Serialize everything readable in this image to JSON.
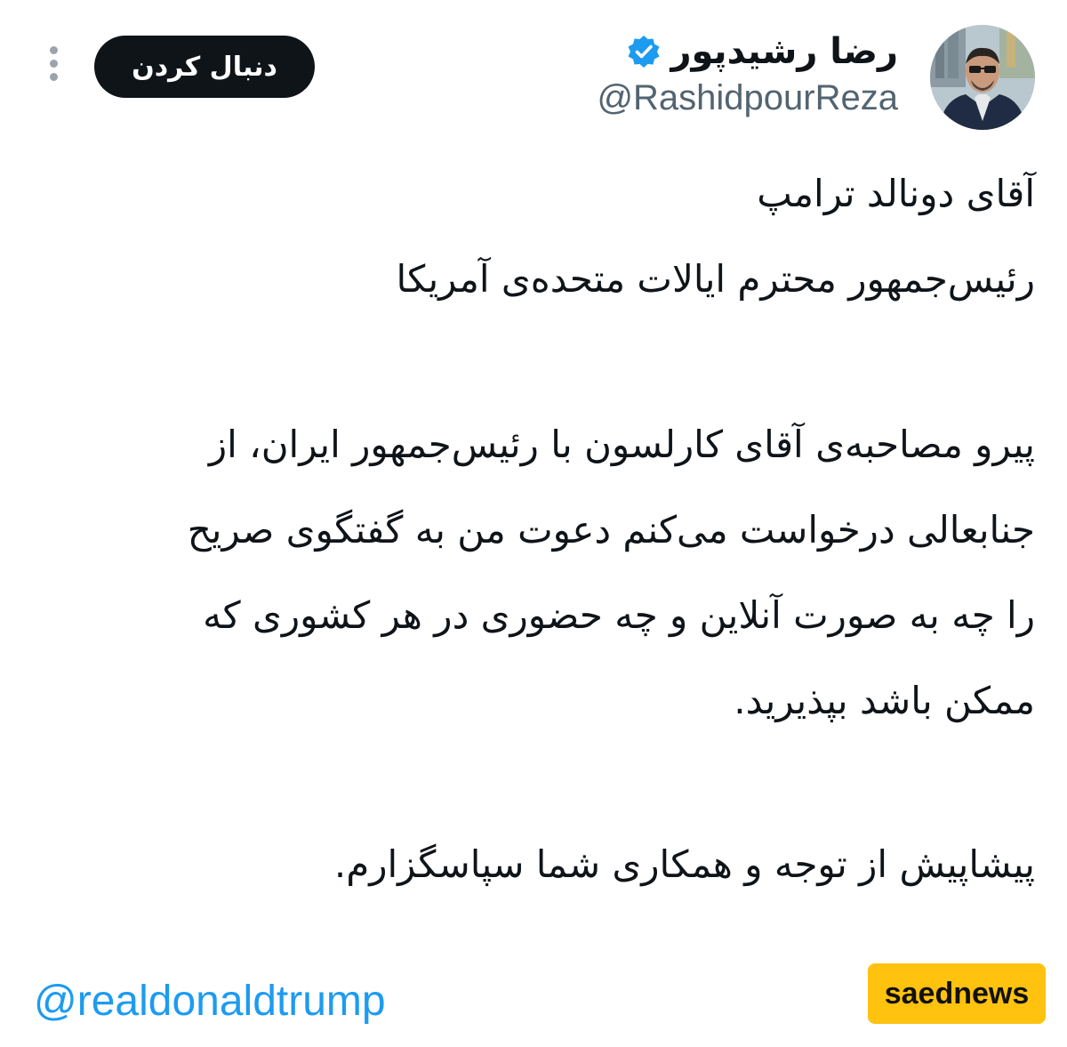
{
  "header": {
    "display_name": "رضا رشیدپور",
    "handle": "@RashidpourReza",
    "follow_label": "دنبال کردن",
    "verified_color": "#1d9bf0",
    "follow_button_color": "#0f1419"
  },
  "tweet": {
    "lines": [
      "آقای دونالد ترامپ",
      "رئیس‌جمهور محترم ایالات متحده‌ی آمریکا",
      "پیرو مصاحبه‌ی آقای کارلسون با رئیس‌جمهور ایران، از",
      "جنابعالی درخواست می‌کنم دعوت من به گفتگوی صریح",
      "را چه به صورت آنلاین و چه حضوری در هر کشوری که",
      "ممکن باشد بپذیرید.",
      "پیشاپیش از توجه و همکاری شما سپاسگزارم."
    ],
    "mention": "@realdonaldtrump"
  },
  "watermark": {
    "text": "saednews",
    "color": "#ffc20e"
  },
  "icons": {
    "more": "more-vertical-icon",
    "verified": "verified-badge-icon",
    "avatar": "profile-avatar"
  }
}
